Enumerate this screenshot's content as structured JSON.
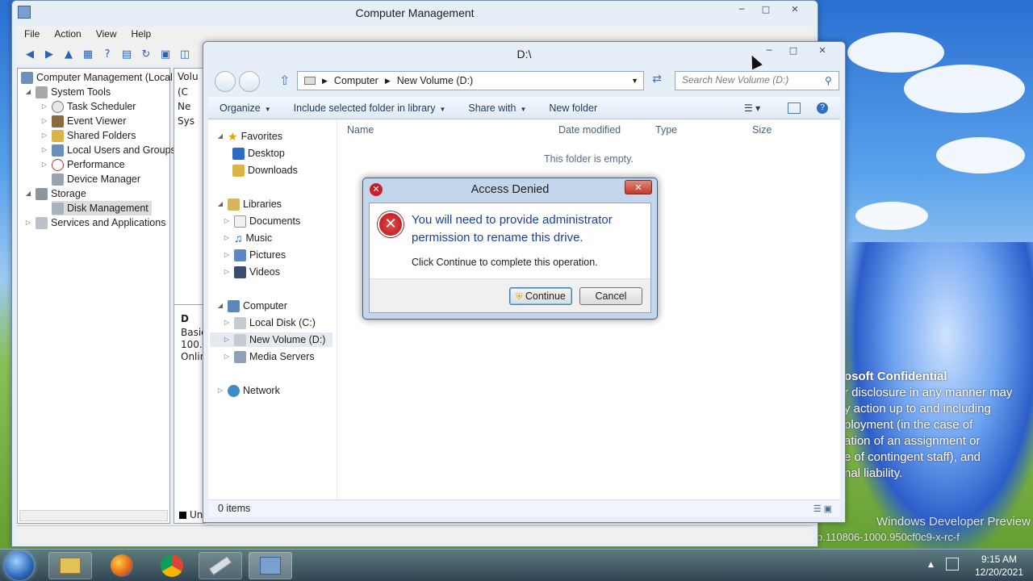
{
  "desktop": {
    "watermark": {
      "line1": "osoft Confidential",
      "line2": "r disclosure in any manner may",
      "line3": "y action up to and including",
      "line4": "ployment (in the case of",
      "line5": "ation of an assignment or",
      "line6": "e of contingent staff), and",
      "line7": "nal liability.",
      "line8": "Windows Developer Preview",
      "line9": "p.110806-1000.950cf0c9-x-rc-f"
    }
  },
  "computer_management": {
    "title": "Computer Management",
    "menu": [
      "File",
      "Action",
      "View",
      "Help"
    ],
    "tree": {
      "root": "Computer Management (Local",
      "system_tools": "System Tools",
      "task_scheduler": "Task Scheduler",
      "event_viewer": "Event Viewer",
      "shared_folders": "Shared Folders",
      "local_users": "Local Users and Groups",
      "performance": "Performance",
      "device_manager": "Device Manager",
      "storage": "Storage",
      "disk_management": "Disk Management",
      "services": "Services and Applications"
    },
    "mid": {
      "header": "Volu",
      "rows": [
        "(C",
        "Ne",
        "Sys"
      ],
      "disk_label": "D",
      "disk_type": "Basic",
      "disk_size": "100.0",
      "disk_status": "Onlin",
      "legend": "Un"
    }
  },
  "explorer": {
    "title": "D:\\",
    "breadcrumb": [
      "Computer",
      "New Volume (D:)"
    ],
    "search_placeholder": "Search New Volume (D:)",
    "commands": {
      "organize": "Organize",
      "include": "Include selected folder in library",
      "share": "Share with",
      "new_folder": "New folder"
    },
    "nav": {
      "favorites": "Favorites",
      "desktop": "Desktop",
      "downloads": "Downloads",
      "libraries": "Libraries",
      "documents": "Documents",
      "music": "Music",
      "pictures": "Pictures",
      "videos": "Videos",
      "computer": "Computer",
      "local_disk": "Local Disk (C:)",
      "new_volume": "New Volume (D:)",
      "media_servers": "Media Servers",
      "network": "Network"
    },
    "columns": {
      "name": "Name",
      "date": "Date modified",
      "type": "Type",
      "size": "Size"
    },
    "empty_text": "This folder is empty.",
    "status": "0 items"
  },
  "dialog": {
    "title": "Access Denied",
    "heading": "You will need to provide administrator permission to rename this drive.",
    "heading_line1": "You will need to provide administrator",
    "heading_line2": "permission to rename this drive.",
    "message": "Click Continue to complete this operation.",
    "continue": "Continue",
    "cancel": "Cancel"
  },
  "taskbar": {
    "time": "9:15 AM",
    "date": "12/20/2021"
  },
  "colors": {
    "heading_blue": "#1a3f9a",
    "error_red": "#c8202a",
    "taskbar": "#3b5270"
  }
}
